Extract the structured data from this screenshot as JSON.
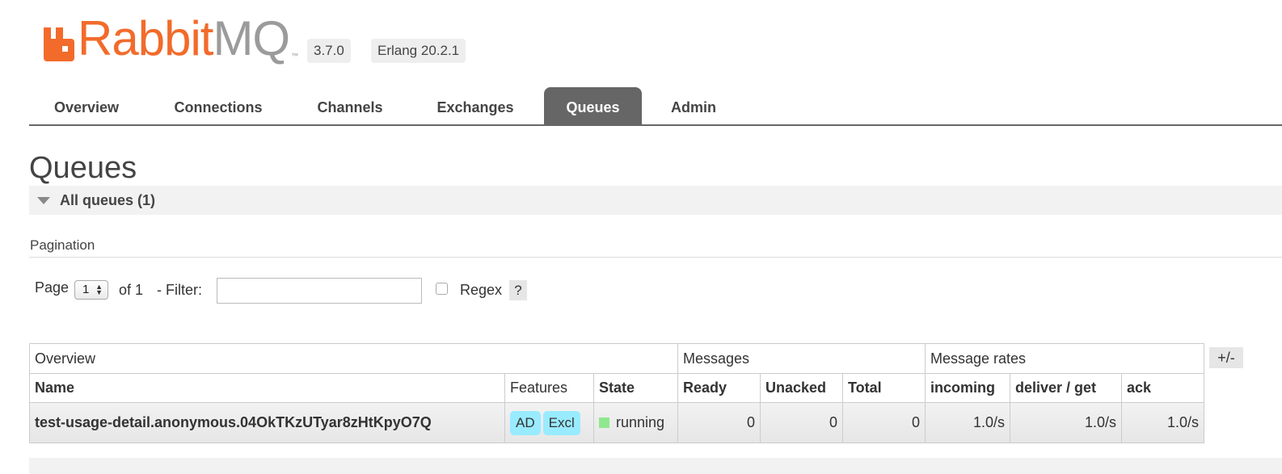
{
  "brand": {
    "name_part1": "Rabbit",
    "name_part2": "MQ",
    "trademark": "™",
    "orange": "#f26b2b",
    "gray": "#9b9b9b"
  },
  "versions": {
    "rabbitmq": "3.7.0",
    "erlang": "Erlang 20.2.1"
  },
  "nav": {
    "tabs": [
      {
        "label": "Overview",
        "active": false
      },
      {
        "label": "Connections",
        "active": false
      },
      {
        "label": "Channels",
        "active": false
      },
      {
        "label": "Exchanges",
        "active": false
      },
      {
        "label": "Queues",
        "active": true
      },
      {
        "label": "Admin",
        "active": false
      }
    ]
  },
  "page": {
    "title": "Queues",
    "section_title": "All queues (1)",
    "pagination_label": "Pagination"
  },
  "pagination": {
    "page_label": "Page",
    "page_value": "1",
    "of_label": "of 1",
    "filter_label": "- Filter:",
    "filter_value": "",
    "regex_label": "Regex",
    "regex_checked": false,
    "help_label": "?"
  },
  "table": {
    "groups": {
      "overview": "Overview",
      "messages": "Messages",
      "rates": "Message rates"
    },
    "columns": {
      "name": "Name",
      "features": "Features",
      "state": "State",
      "ready": "Ready",
      "unacked": "Unacked",
      "total": "Total",
      "incoming": "incoming",
      "deliver_get": "deliver / get",
      "ack": "ack"
    },
    "rows": [
      {
        "name": "test-usage-detail.anonymous.04OkTKzUTyar8zHtKpyO7Q",
        "features": [
          "AD",
          "Excl"
        ],
        "state": "running",
        "ready": "0",
        "unacked": "0",
        "total": "0",
        "incoming": "1.0/s",
        "deliver_get": "1.0/s",
        "ack": "1.0/s"
      }
    ],
    "column_toggle": "+/-"
  },
  "colors": {
    "active_tab": "#666666",
    "feature_tag": "#99ebff",
    "state_running": "#8fe88f"
  }
}
